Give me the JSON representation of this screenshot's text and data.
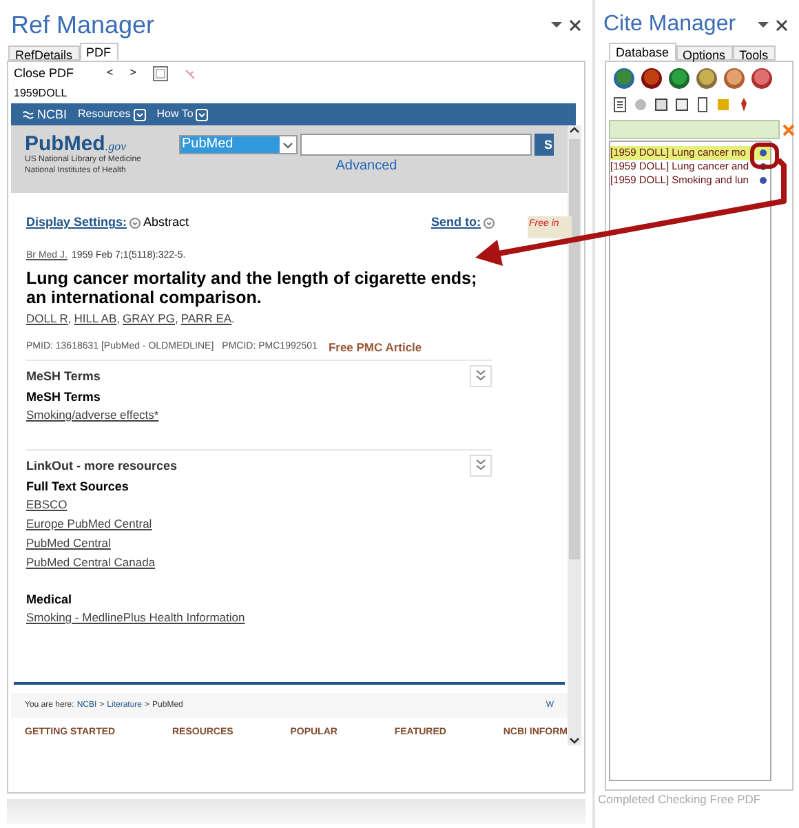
{
  "ref_manager": {
    "title": "Ref Manager",
    "tabs": [
      {
        "label": "RefDetails",
        "selected": false
      },
      {
        "label": "PDF",
        "selected": true
      }
    ],
    "toolbar": {
      "close": "Close PDF",
      "prev": "<",
      "next": ">"
    },
    "record_id": "1959DOLL",
    "browser": {
      "ncbi_bar": {
        "brand": "NCBI",
        "menus": [
          "Resources",
          "How To"
        ]
      },
      "pubmed_header": {
        "logo": "PubMed",
        "logo_suffix": ".gov",
        "org_lines": [
          "US National Library of Medicine",
          "National Institutes of Health"
        ],
        "database": "PubMed",
        "search_button": "S",
        "advanced": "Advanced"
      },
      "display_settings": "Display Settings:",
      "format": "Abstract",
      "send_to": "Send to:",
      "pmc_badge": "Free in",
      "citation": {
        "journal": "Br Med J.",
        "details": "1959 Feb 7;1(5118):322-5."
      },
      "title": "Lung cancer mortality and the length of cigarette ends; an international comparison.",
      "authors": [
        {
          "name": "DOLL R",
          "sep": ","
        },
        {
          "name": "HILL AB",
          "sep": ","
        },
        {
          "name": "GRAY PG",
          "sep": ","
        },
        {
          "name": "PARR EA",
          "sep": "."
        }
      ],
      "pmid": "PMID: 13618631 [PubMed - OLDMEDLINE]",
      "pmcid": "PMCID: PMC1992501",
      "free_link": "Free PMC Article",
      "sections": [
        {
          "heading": "MeSH Terms",
          "groups": [
            {
              "title": "MeSH Terms",
              "links": [
                "Smoking/adverse effects*"
              ]
            }
          ]
        },
        {
          "heading": "LinkOut - more resources",
          "groups": [
            {
              "title": "Full Text Sources",
              "links": [
                "EBSCO",
                "Europe PubMed Central",
                "PubMed Central",
                "PubMed Central Canada"
              ]
            },
            {
              "title": "Medical",
              "links": [
                "Smoking - MedlinePlus Health Information"
              ]
            }
          ]
        }
      ],
      "breadcrumb": {
        "label": "You are here:",
        "separator": ">",
        "items": [
          "NCBI",
          "Literature",
          "PubMed"
        ],
        "right": "W"
      },
      "footer_nav": [
        "GETTING STARTED",
        "RESOURCES",
        "POPULAR",
        "FEATURED",
        "NCBI INFORM"
      ]
    }
  },
  "cite_manager": {
    "title": "Cite Manager",
    "tabs": [
      {
        "label": "Database",
        "selected": true
      },
      {
        "label": "Options",
        "selected": false
      },
      {
        "label": "Tools",
        "selected": false
      }
    ],
    "references": [
      {
        "text": "[1959 DOLL] Lung cancer mo",
        "selected": true
      },
      {
        "text": "[1959 DOLL] Lung cancer and",
        "selected": false
      },
      {
        "text": "[1959 DOLL] Smoking and lun",
        "selected": false
      }
    ],
    "status": "Completed Checking Free PDF"
  }
}
